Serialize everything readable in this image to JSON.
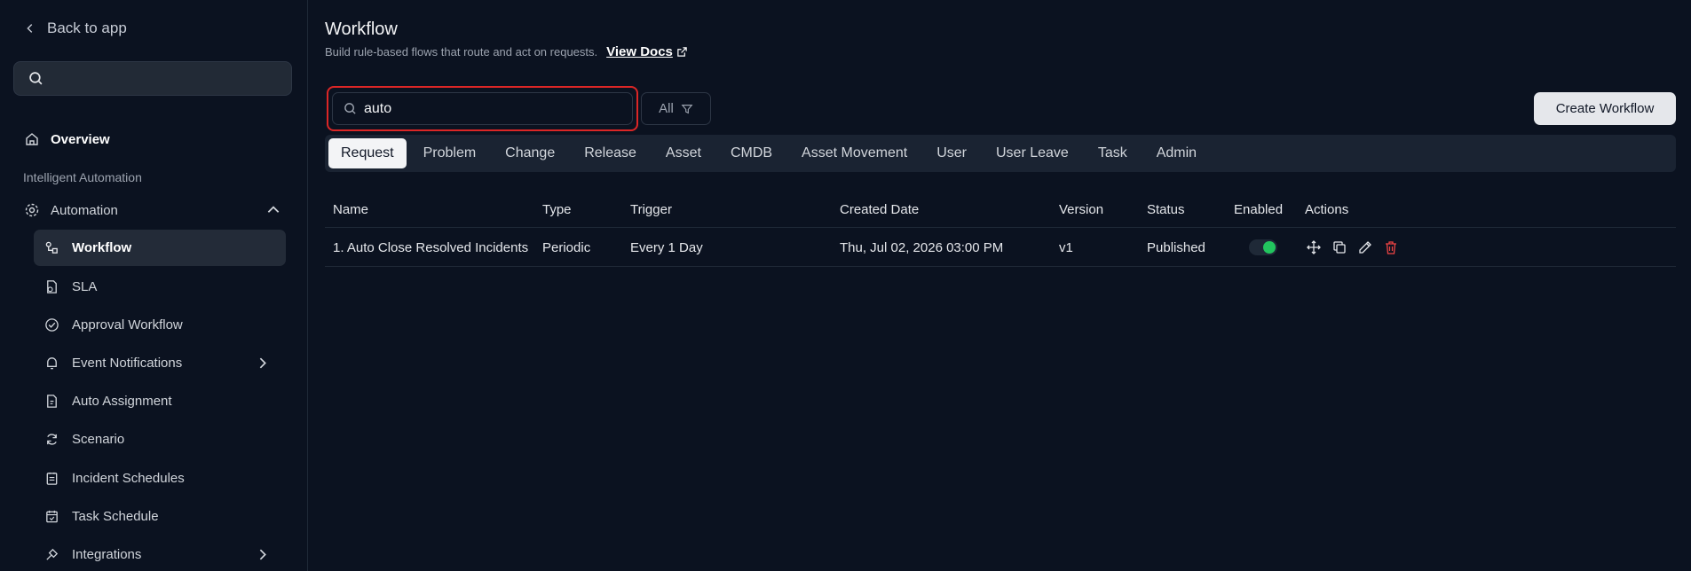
{
  "sidebar": {
    "back_label": "Back to app",
    "search_placeholder": "",
    "overview_label": "Overview",
    "section_label": "Intelligent Automation",
    "automation_label": "Automation",
    "items": [
      {
        "label": "Workflow",
        "icon": "workflow-icon"
      },
      {
        "label": "SLA",
        "icon": "sla-icon"
      },
      {
        "label": "Approval Workflow",
        "icon": "check-circle-icon"
      },
      {
        "label": "Event Notifications",
        "icon": "bell-icon"
      },
      {
        "label": "Auto Assignment",
        "icon": "assignment-icon"
      },
      {
        "label": "Scenario",
        "icon": "refresh-icon"
      },
      {
        "label": "Incident Schedules",
        "icon": "clipboard-icon"
      },
      {
        "label": "Task Schedule",
        "icon": "calendar-check-icon"
      },
      {
        "label": "Integrations",
        "icon": "plug-icon"
      }
    ]
  },
  "header": {
    "title": "Workflow",
    "subtitle": "Build rule-based flows that route and act on requests.",
    "docs_label": "View Docs"
  },
  "toolbar": {
    "search_value": "auto",
    "filter_label": "All",
    "create_label": "Create Workflow"
  },
  "tabs": [
    "Request",
    "Problem",
    "Change",
    "Release",
    "Asset",
    "CMDB",
    "Asset Movement",
    "User",
    "User Leave",
    "Task",
    "Admin"
  ],
  "table": {
    "headers": [
      "Name",
      "Type",
      "Trigger",
      "Created Date",
      "Version",
      "Status",
      "Enabled",
      "Actions"
    ],
    "rows": [
      {
        "name": "1. Auto Close Resolved Incidents",
        "type": "Periodic",
        "trigger": "Every 1 Day",
        "created": "Thu, Jul 02, 2026 03:00 PM",
        "version": "v1",
        "status": "Published",
        "enabled": true
      }
    ]
  },
  "colors": {
    "background": "#0b1220",
    "highlight": "#dc2626",
    "toggle_on": "#22c55e",
    "delete": "#ef4444"
  }
}
